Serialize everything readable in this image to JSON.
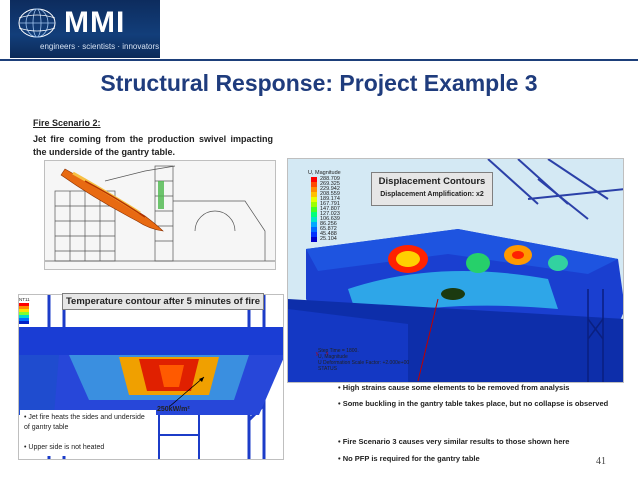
{
  "header": {
    "logo_text": "MMI",
    "tagline": "engineers · scientists · innovators"
  },
  "slide": {
    "title": "Structural Response: Project Example 3",
    "page_number": "41"
  },
  "fire_scenario": {
    "heading": "Fire Scenario 2:",
    "description": "Jet fire coming from the production swivel impacting the underside of the gantry table."
  },
  "displacement_box": {
    "title": "Displacement Contours",
    "amplification": "Displacement Amplification:   x2"
  },
  "magnitude_legend": {
    "title": "U, Magnitude",
    "values": [
      "288.709",
      "269.325",
      "229.942",
      "208.559",
      "189.174",
      "167.791",
      "147.807",
      "127.023",
      "106.639",
      "86.256",
      "65.872",
      "45.488",
      "25.104"
    ],
    "colors": [
      "#ff0000",
      "#ff4a00",
      "#ff8c00",
      "#ffc000",
      "#e6ff00",
      "#9cff00",
      "#42ff24",
      "#00ff7a",
      "#00e6c8",
      "#00a8ff",
      "#0068ff",
      "#0030ff",
      "#0000c8"
    ]
  },
  "temperature_box": {
    "title": "Temperature contour after 5 minutes of fire"
  },
  "nt_legend": {
    "title": "NT11"
  },
  "power_label": "250kW/m²",
  "left_bullets": [
    "• Jet fire heats the sides and underside of gantry table",
    "• Upper side is not heated"
  ],
  "right_bullets": [
    "• High strains cause some elements to be removed from analysis",
    "• Some buckling in the gantry table takes place, but no collapse is observed",
    "• Fire Scenario 3 causes very similar results to those shown here",
    "• No PFP is required for the gantry table"
  ],
  "sim_info": {
    "step_time": "Step Time =    1800.",
    "variable": "U, Magnitude",
    "deformation": "U   Deformation Scale Factor: +2.000e+00",
    "status": "STATUS"
  }
}
